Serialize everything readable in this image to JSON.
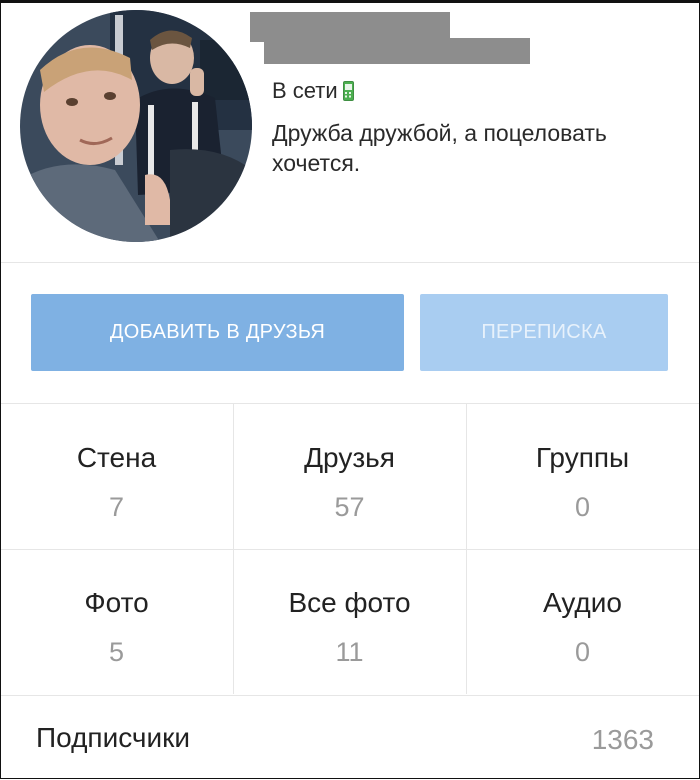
{
  "profile": {
    "online_label": "В сети",
    "status": "Дружба дружбой, а поцеловать хочется."
  },
  "actions": {
    "add_friend_label": "ДОБАВИТЬ В ДРУЗЬЯ",
    "message_label": "ПЕРЕПИСКА"
  },
  "counters": [
    {
      "label": "Стена",
      "value": "7"
    },
    {
      "label": "Друзья",
      "value": "57"
    },
    {
      "label": "Группы",
      "value": "0"
    },
    {
      "label": "Фото",
      "value": "5"
    },
    {
      "label": "Все фото",
      "value": "11"
    },
    {
      "label": "Аудио",
      "value": "0"
    }
  ],
  "subscribers": {
    "label": "Подписчики",
    "value": "1363"
  },
  "colors": {
    "add_button": "#7fb1e3",
    "message_button": "#a9cdf1",
    "online_icon": "#4caf50"
  },
  "icons": {
    "online": "mobile-phone-icon"
  }
}
